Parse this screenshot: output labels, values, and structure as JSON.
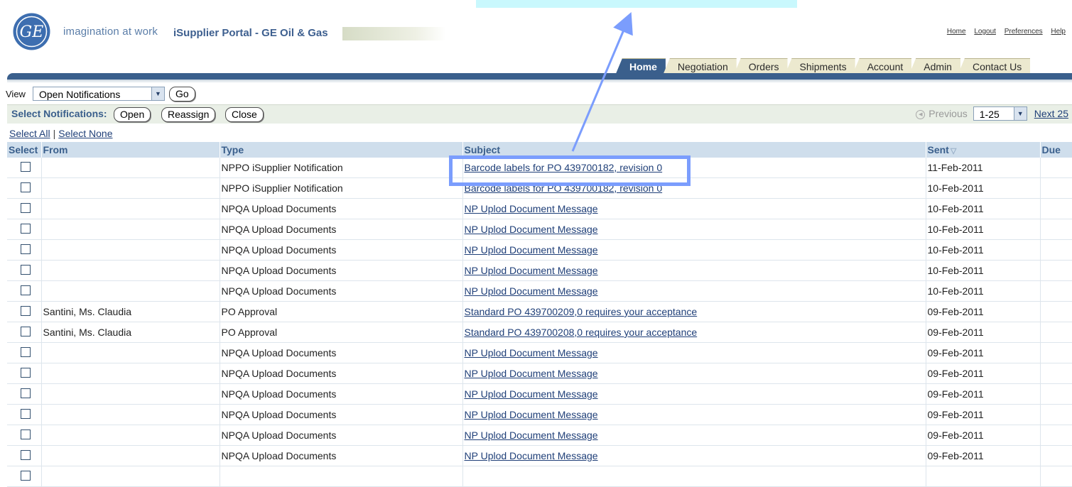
{
  "header": {
    "logo_text": "GE",
    "tagline": "imagination at work",
    "portal_title": "iSupplier Portal - GE Oil & Gas",
    "global_links": [
      "Home",
      "Logout",
      "Preferences",
      "Help"
    ]
  },
  "tabs": [
    {
      "label": "Home",
      "active": true
    },
    {
      "label": "Negotiation",
      "active": false
    },
    {
      "label": "Orders",
      "active": false
    },
    {
      "label": "Shipments",
      "active": false
    },
    {
      "label": "Account",
      "active": false
    },
    {
      "label": "Admin",
      "active": false
    },
    {
      "label": "Contact Us",
      "active": false
    }
  ],
  "view": {
    "label": "View",
    "selected": "Open Notifications",
    "go_label": "Go"
  },
  "toolbar": {
    "label": "Select Notifications:",
    "open_label": "Open",
    "reassign_label": "Reassign",
    "close_label": "Close",
    "previous_label": "Previous",
    "range_selected": "1-25",
    "next_label": "Next 25"
  },
  "select_links": {
    "select_all": "Select All",
    "separator": "|",
    "select_none": "Select None"
  },
  "table": {
    "columns": [
      "Select",
      "From",
      "Type",
      "Subject",
      "Sent",
      "Due"
    ],
    "rows": [
      {
        "from": "",
        "type": "NPPO iSupplier Notification",
        "subject": "Barcode labels for PO 439700182, revision 0",
        "sent": "11-Feb-2011",
        "due": ""
      },
      {
        "from": "",
        "type": "NPPO iSupplier Notification",
        "subject": "Barcode labels for PO 439700182, revision 0",
        "sent": "10-Feb-2011",
        "due": ""
      },
      {
        "from": "",
        "type": "NPQA Upload Documents",
        "subject": "NP Uplod Document Message",
        "sent": "10-Feb-2011",
        "due": ""
      },
      {
        "from": "",
        "type": "NPQA Upload Documents",
        "subject": "NP Uplod Document Message",
        "sent": "10-Feb-2011",
        "due": ""
      },
      {
        "from": "",
        "type": "NPQA Upload Documents",
        "subject": "NP Uplod Document Message",
        "sent": "10-Feb-2011",
        "due": ""
      },
      {
        "from": "",
        "type": "NPQA Upload Documents",
        "subject": "NP Uplod Document Message",
        "sent": "10-Feb-2011",
        "due": ""
      },
      {
        "from": "",
        "type": "NPQA Upload Documents",
        "subject": "NP Uplod Document Message",
        "sent": "10-Feb-2011",
        "due": ""
      },
      {
        "from": "Santini, Ms. Claudia",
        "type": "PO Approval",
        "subject": "Standard PO 439700209,0 requires your acceptance",
        "sent": "09-Feb-2011",
        "due": ""
      },
      {
        "from": "Santini, Ms. Claudia",
        "type": "PO Approval",
        "subject": "Standard PO 439700208,0 requires your acceptance",
        "sent": "09-Feb-2011",
        "due": ""
      },
      {
        "from": "",
        "type": "NPQA Upload Documents",
        "subject": "NP Uplod Document Message",
        "sent": "09-Feb-2011",
        "due": ""
      },
      {
        "from": "",
        "type": "NPQA Upload Documents",
        "subject": "NP Uplod Document Message",
        "sent": "09-Feb-2011",
        "due": ""
      },
      {
        "from": "",
        "type": "NPQA Upload Documents",
        "subject": "NP Uplod Document Message",
        "sent": "09-Feb-2011",
        "due": ""
      },
      {
        "from": "",
        "type": "NPQA Upload Documents",
        "subject": "NP Uplod Document Message",
        "sent": "09-Feb-2011",
        "due": ""
      },
      {
        "from": "",
        "type": "NPQA Upload Documents",
        "subject": "NP Uplod Document Message",
        "sent": "09-Feb-2011",
        "due": ""
      },
      {
        "from": "",
        "type": "NPQA Upload Documents",
        "subject": "NP Uplod Document Message",
        "sent": "09-Feb-2011",
        "due": ""
      },
      {
        "from": "",
        "type": "",
        "subject": "",
        "sent": "",
        "due": ""
      }
    ]
  },
  "icons": {
    "dropdown": "chevron-down-icon",
    "sort": "sort-descending-icon",
    "previous": "previous-arrow-icon"
  },
  "colors": {
    "brand_blue": "#3a5f8c",
    "tab_inactive": "#ece9cf",
    "header_row": "#cfdeec",
    "toolbar_bg": "#e9efe6",
    "link": "#1f3f78",
    "annotation_box": "#7b9dfd",
    "annotation_callout": "#c9f8fd"
  }
}
